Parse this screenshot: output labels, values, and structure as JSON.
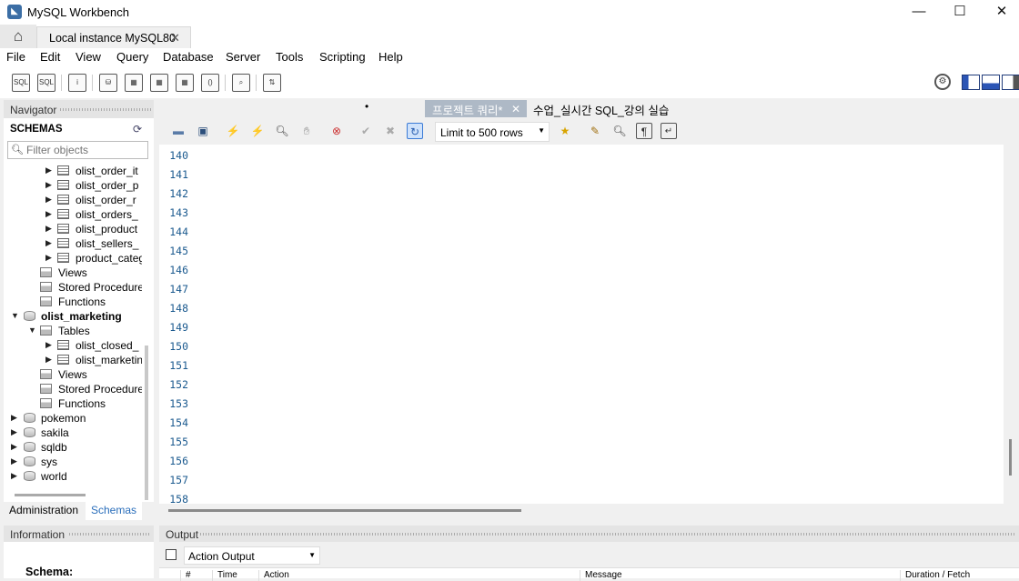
{
  "window": {
    "title": "MySQL Workbench",
    "minimize": "—",
    "maximize": "☐",
    "close": "✕"
  },
  "connection_tab": {
    "label": "Local instance MySQL80",
    "close": "✕"
  },
  "menu": [
    "File",
    "Edit",
    "View",
    "Query",
    "Database",
    "Server",
    "Tools",
    "Scripting",
    "Help"
  ],
  "navigator": {
    "title": "Navigator",
    "schemas_label": "SCHEMAS",
    "filter_placeholder": "Filter objects",
    "tree": [
      {
        "label": "olist_order_it",
        "icon": "table-icon"
      },
      {
        "label": "olist_order_p",
        "icon": "table-icon"
      },
      {
        "label": "olist_order_r",
        "icon": "table-icon"
      },
      {
        "label": "olist_orders_",
        "icon": "table-icon"
      },
      {
        "label": "olist_product",
        "icon": "table-icon"
      },
      {
        "label": "olist_sellers_",
        "icon": "table-icon"
      },
      {
        "label": "product_categ",
        "icon": "table-icon"
      },
      {
        "label": "Views",
        "icon": "folder-icon"
      },
      {
        "label": "Stored Procedure",
        "icon": "folder-icon"
      },
      {
        "label": "Functions",
        "icon": "folder-icon"
      },
      {
        "label": "olist_marketing",
        "icon": "database-icon"
      },
      {
        "label": "Tables",
        "icon": "folder-icon"
      },
      {
        "label": "olist_closed_",
        "icon": "table-icon"
      },
      {
        "label": "olist_marketin",
        "icon": "table-icon"
      },
      {
        "label": "Views",
        "icon": "folder-icon"
      },
      {
        "label": "Stored Procedure",
        "icon": "folder-icon"
      },
      {
        "label": "Functions",
        "icon": "folder-icon"
      },
      {
        "label": "pokemon",
        "icon": "database-icon"
      },
      {
        "label": "sakila",
        "icon": "database-icon"
      },
      {
        "label": "sqldb",
        "icon": "database-icon"
      },
      {
        "label": "sys",
        "icon": "database-icon"
      },
      {
        "label": "world",
        "icon": "database-icon"
      }
    ],
    "tabs": [
      "Administration",
      "Schemas"
    ]
  },
  "information": {
    "title": "Information",
    "schema_label": "Schema:"
  },
  "editor_tabs": {
    "dot": "•",
    "active": "프로젝트 쿼리*",
    "active_close": "✕",
    "other": "수업_실시간 SQL_강의 실습"
  },
  "editor_toolbar": {
    "limit_label": "Limit to 500 rows"
  },
  "editor": {
    "line_numbers": [
      "140",
      "141",
      "142",
      "143",
      "144",
      "145",
      "146",
      "147",
      "148",
      "149",
      "150",
      "151",
      "152",
      "153",
      "154",
      "155",
      "156",
      "157",
      "158"
    ]
  },
  "output": {
    "title": "Output",
    "selected": "Action Output",
    "columns": [
      "#",
      "Time",
      "Action",
      "Message",
      "Duration / Fetch"
    ]
  }
}
